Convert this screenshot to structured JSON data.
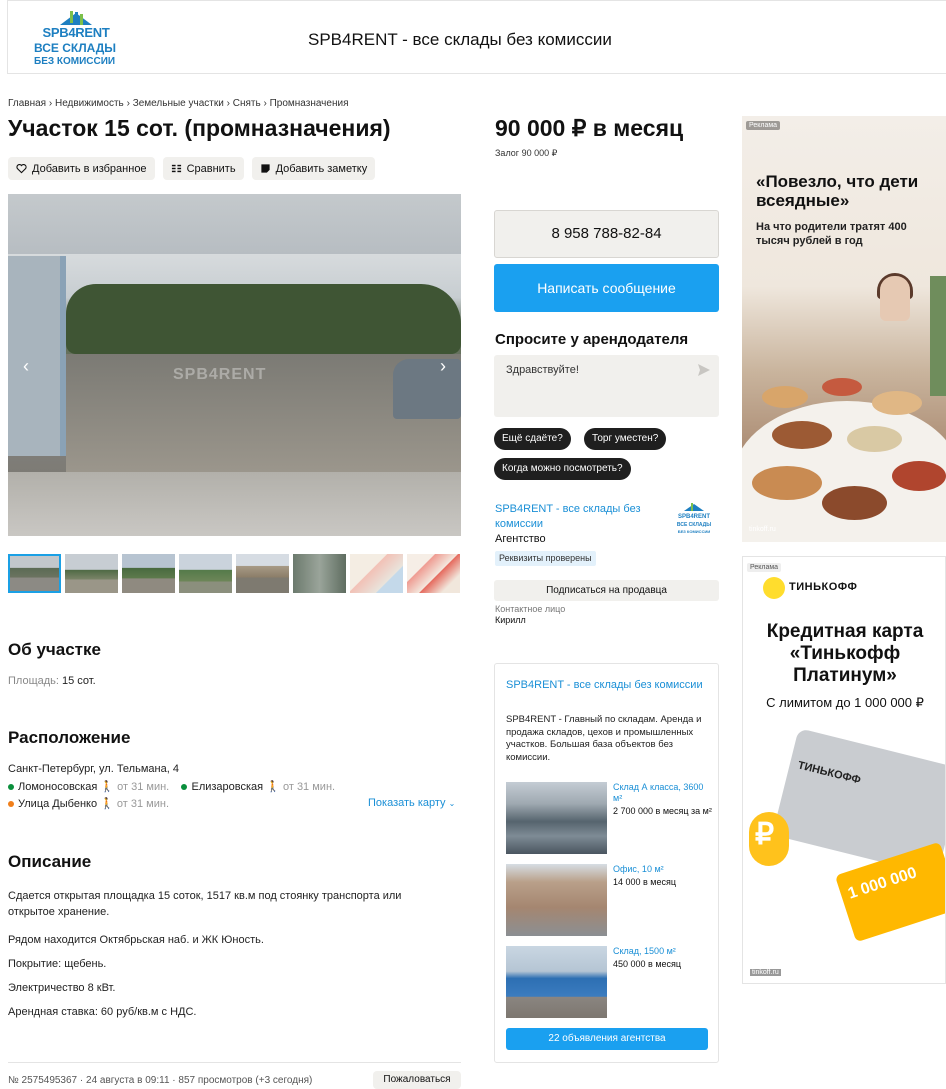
{
  "header": {
    "brand": "SPB4RENT",
    "brand_line2": "ВСЕ СКЛАДЫ",
    "brand_line3": "БЕЗ КОМИССИИ",
    "title": "SPB4RENT - все склады без комиссии"
  },
  "breadcrumb": [
    "Главная",
    "Недвижимость",
    "Земельные участки",
    "Снять",
    "Промназначения"
  ],
  "breadcrumb_sep": "›",
  "listing": {
    "title": "Участок 15 сот. (промназначения)",
    "price": "90 000 ₽ в месяц",
    "deposit": "Залог 90 000 ₽",
    "actions": {
      "favorite": "Добавить в избранное",
      "compare": "Сравнить",
      "note": "Добавить заметку"
    },
    "watermark": "SPB4RENT",
    "thumbnail_count": 8
  },
  "about": {
    "heading": "Об участке",
    "area_label": "Площадь:",
    "area_value": "15 сот."
  },
  "location": {
    "heading": "Расположение",
    "address": "Санкт-Петербург, ул. Тельмана, 4",
    "metro": [
      {
        "name": "Ломоносовская",
        "time": "от 31 мин.",
        "color": "#0a8f3c"
      },
      {
        "name": "Елизаровская",
        "time": "от 31 мин.",
        "color": "#0a8f3c"
      },
      {
        "name": "Улица Дыбенко",
        "time": "от 31 мин.",
        "color": "#f07f1b"
      }
    ],
    "show_map": "Показать карту"
  },
  "description": {
    "heading": "Описание",
    "paragraphs": [
      "Сдается открытая площадка 15 соток, 1517 кв.м под стоянку транспорта или открытое хранение.",
      "Рядом находится Октябрьская наб. и ЖК Юность.",
      "Покрытие: щебень.",
      "Электричество 8 кВт.",
      "Арендная ставка: 60 руб/кв.м с НДС."
    ]
  },
  "footer": {
    "meta": "№ 2575495367 · 24 августа в 09:11 · 857 просмотров (+3 сегодня)",
    "complain": "Пожаловаться"
  },
  "contact": {
    "phone": "8 958 788-82-84",
    "message": "Написать сообщение",
    "ask_heading": "Спросите у арендодателя",
    "ask_value": "Здравствуйте!",
    "chips": [
      "Ещё сдаёте?",
      "Торг уместен?",
      "Когда можно посмотреть?"
    ],
    "seller_name": "SPB4RENT - все склады без комиссии",
    "seller_type": "Агентство",
    "verified": "Реквизиты проверены",
    "subscribe": "Подписаться на продавца",
    "contact_label": "Контактное лицо",
    "contact_name": "Кирилл"
  },
  "agency": {
    "name": "SPB4RENT - все склады без комиссии",
    "description": "SPB4RENT - Главный по складам. Аренда и продажа складов, цехов и промышленных участков. Большая база объектов без комиссии.",
    "listings": [
      {
        "title": "Склад А класса, 3600 м²",
        "price": "2 700 000 в месяц за м²"
      },
      {
        "title": "Офис, 10 м²",
        "price": "14 000 в месяц"
      },
      {
        "title": "Склад, 1500 м²",
        "price": "450 000 в месяц"
      }
    ],
    "all_button": "22 объявления агентства"
  },
  "ads": {
    "label": "Реклама",
    "ad1": {
      "headline": "«Повезло, что дети всеядные»",
      "sub": "На что родители тратят 400 тысяч рублей в год",
      "domain": "tinkoff.ru"
    },
    "ad2": {
      "brand": "ТИНЬКОФФ",
      "headline": "Кредитная карта «Тинькофф Платинум»",
      "sub": "С лимитом до 1 000 000 ₽",
      "card_text": "ТИНЬКОФФ",
      "sticker": "1 000 000",
      "domain": "tinkoff.ru"
    }
  },
  "colors": {
    "accent": "#1aa0f0",
    "link": "#1a8fd6",
    "button_gray": "#f1f0ed"
  }
}
